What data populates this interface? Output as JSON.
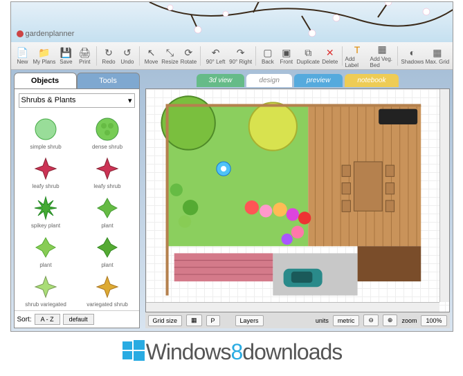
{
  "app": {
    "name": "gardenplanner"
  },
  "toolbar": {
    "groups": [
      [
        "New",
        "My Plans",
        "Save",
        "Print"
      ],
      [
        "Redo",
        "Undo"
      ],
      [
        "Move",
        "Resize",
        "Rotate"
      ],
      [
        "90° Left",
        "90° Right"
      ],
      [
        "Back",
        "Front",
        "Duplicate",
        "Delete"
      ],
      [
        "Add Label",
        "Add Veg. Bed"
      ],
      [
        "Shadows",
        "Max. Grid"
      ]
    ]
  },
  "sidebar": {
    "tabs": [
      "Objects",
      "Tools"
    ],
    "active_tab": 0,
    "category": "Shrubs & Plants",
    "items": [
      {
        "label": "simple shrub"
      },
      {
        "label": "dense shrub"
      },
      {
        "label": "leafy shrub"
      },
      {
        "label": "leafy shrub"
      },
      {
        "label": "spikey plant"
      },
      {
        "label": "plant"
      },
      {
        "label": "plant"
      },
      {
        "label": "plant"
      },
      {
        "label": "shrub variegated"
      },
      {
        "label": "variegated shrub"
      }
    ],
    "sort_label": "Sort:",
    "sort_buttons": [
      "A - Z",
      "default"
    ]
  },
  "canvas_tabs": [
    "3d view",
    "design",
    "preview",
    "notebook"
  ],
  "canvas_active_tab": 1,
  "bottombar": {
    "gridsize_label": "Grid size",
    "layers_label": "Layers",
    "units_label": "units",
    "units_value": "metric",
    "zoom_label": "zoom",
    "zoom_value": "100%"
  },
  "watermark": {
    "prefix": "Windows",
    "highlight": "8",
    "suffix": "downloads"
  }
}
